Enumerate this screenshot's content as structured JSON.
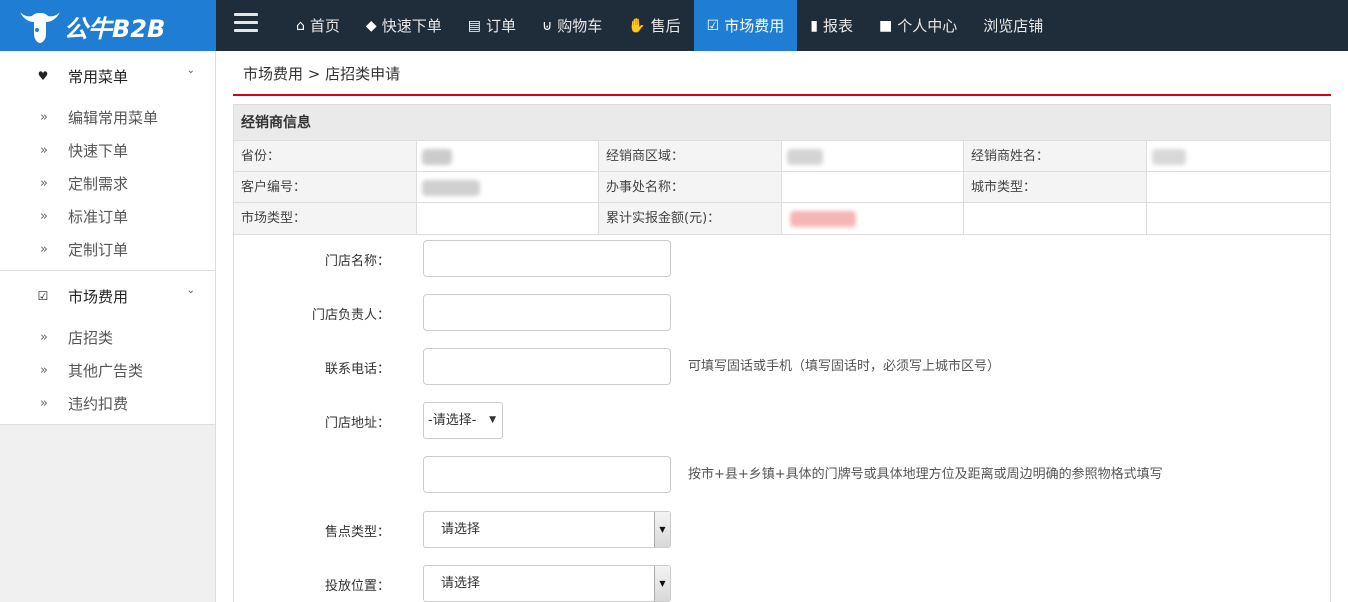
{
  "brand": {
    "name": "公牛B2B",
    "bg": "#1f7ed3"
  },
  "topnav": {
    "items": [
      {
        "icon": "home-icon",
        "label": "首页"
      },
      {
        "icon": "tag-icon",
        "label": "快速下单"
      },
      {
        "icon": "list-icon",
        "label": "订单"
      },
      {
        "icon": "cart-icon",
        "label": "购物车"
      },
      {
        "icon": "thumbs-up-icon",
        "label": "售后"
      },
      {
        "icon": "check-square-icon",
        "label": "市场费用",
        "active": true
      },
      {
        "icon": "bar-chart-icon",
        "label": "报表"
      },
      {
        "icon": "bookmark-icon",
        "label": "个人中心"
      },
      {
        "icon": "",
        "label": "浏览店铺"
      }
    ]
  },
  "sidebar": {
    "groups": [
      {
        "icon": "heart-icon",
        "title": "常用菜单",
        "items": [
          "编辑常用菜单",
          "快速下单",
          "定制需求",
          "标准订单",
          "定制订单"
        ]
      },
      {
        "icon": "check-square-icon",
        "title": "市场费用",
        "items": [
          "店招类",
          "其他广告类",
          "违约扣费"
        ]
      }
    ]
  },
  "breadcrumb": "市场费用 > 店招类申请",
  "dealer_info": {
    "title": "经销商信息",
    "rows": [
      [
        "省份：",
        "经销商区域：",
        "经销商姓名："
      ],
      [
        "客户编号：",
        "办事处名称：",
        "城市类型："
      ],
      [
        "市场类型：",
        "累计实报金额(元)：",
        ""
      ]
    ]
  },
  "form": {
    "store_name_label": "门店名称：",
    "store_owner_label": "门店负责人：",
    "phone_label": "联系电话：",
    "phone_hint": "可填写固话或手机（填写固话时，必须写上城市区号）",
    "address_label": "门店地址：",
    "address_select": "-请选择-",
    "address_hint": "按市+县+乡镇+具体的门牌号或具体地理方位及距离或周边明确的参照物格式填写",
    "sale_type_label": "售点类型：",
    "sale_type_value": "请选择",
    "placement_label": "投放位置：",
    "placement_value": "请选择"
  },
  "colors": {
    "topbar": "#1f2d3a",
    "accent": "#1f7ed3",
    "divider": "#d9001b"
  }
}
